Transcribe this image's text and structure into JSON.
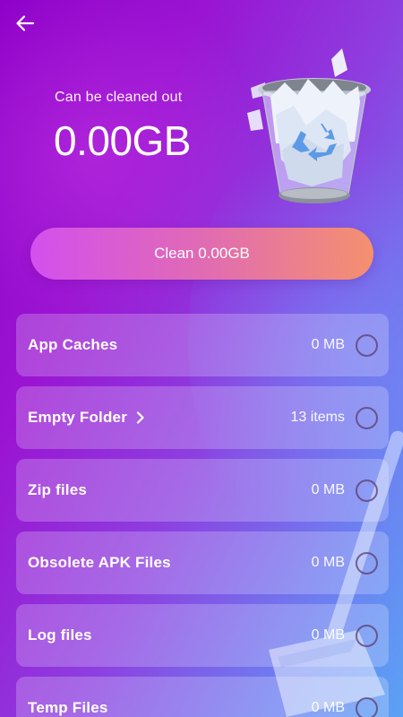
{
  "header": {
    "back_icon": "arrow-left-icon",
    "subtitle": "Can be cleaned out",
    "amount": "0.00GB",
    "illustration": "recycle-bin-icon"
  },
  "actions": {
    "clean_label": "Clean 0.00GB"
  },
  "items": [
    {
      "label": "App Caches",
      "value": "0 MB",
      "has_chevron": false
    },
    {
      "label": "Empty Folder",
      "value": "13 items",
      "has_chevron": true
    },
    {
      "label": "Zip files",
      "value": "0 MB",
      "has_chevron": false
    },
    {
      "label": "Obsolete APK Files",
      "value": "0 MB",
      "has_chevron": false
    },
    {
      "label": "Log files",
      "value": "0 MB",
      "has_chevron": false
    },
    {
      "label": "Temp Files",
      "value": "0 MB",
      "has_chevron": false
    }
  ],
  "colors": {
    "background_start": "#8f00c8",
    "background_end": "#5aa2f5",
    "button_start": "#d350ee",
    "button_end": "#f5906e"
  }
}
